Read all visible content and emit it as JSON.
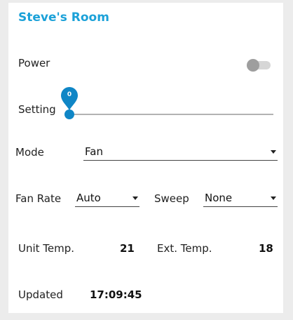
{
  "room": {
    "title": "Steve's Room"
  },
  "power": {
    "label": "Power",
    "on": false
  },
  "setting": {
    "label": "Setting",
    "value": "0"
  },
  "mode": {
    "label": "Mode",
    "selected": "Fan"
  },
  "fan_rate": {
    "label": "Fan Rate",
    "selected": "Auto"
  },
  "sweep": {
    "label": "Sweep",
    "selected": "None"
  },
  "unit_temp": {
    "label": "Unit Temp.",
    "value": "21"
  },
  "ext_temp": {
    "label": "Ext. Temp.",
    "value": "18"
  },
  "updated": {
    "label": "Updated",
    "value": "17:09:45"
  },
  "colors": {
    "accent": "#1ba1d8",
    "slider": "#0f86c6",
    "toggle_off": "#9e9e9e"
  },
  "icons": {
    "dropdown": "caret-down-icon",
    "slider_pin": "slider-value-pin"
  }
}
